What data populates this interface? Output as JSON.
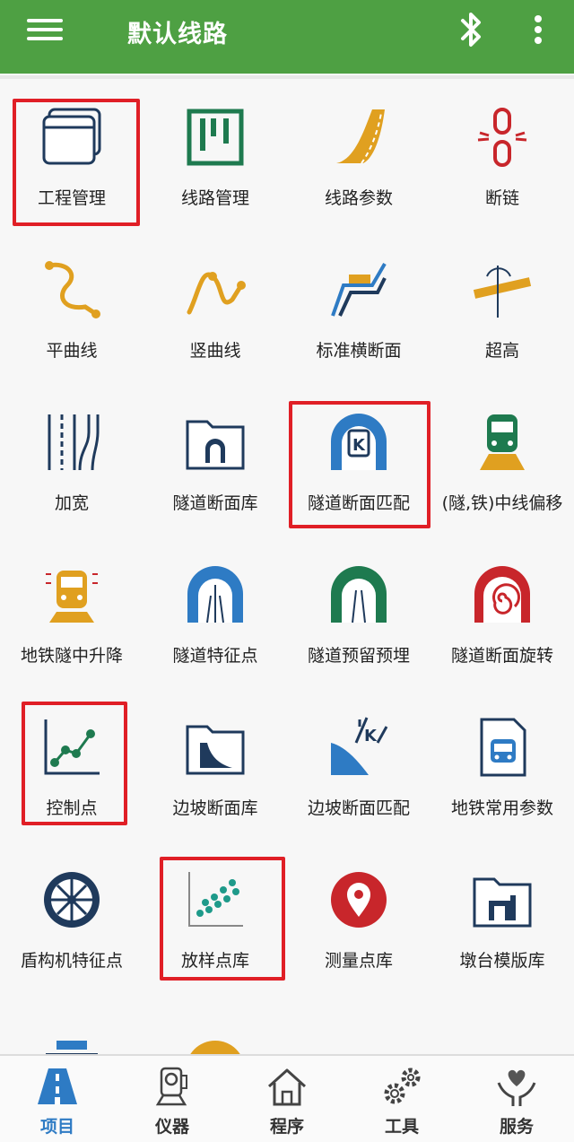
{
  "appbar": {
    "title": "默认线路",
    "menu_icon": "hamburger-icon",
    "bluetooth_icon": "bluetooth-icon",
    "more_icon": "more-vertical-icon"
  },
  "grid": {
    "items": [
      {
        "label": "工程管理",
        "icon": "project-window-icon"
      },
      {
        "label": "线路管理",
        "icon": "route-frame-icon"
      },
      {
        "label": "线路参数",
        "icon": "road-curve-icon"
      },
      {
        "label": "断链",
        "icon": "broken-chain-icon"
      },
      {
        "label": "平曲线",
        "icon": "horizontal-curve-icon"
      },
      {
        "label": "竖曲线",
        "icon": "vertical-curve-icon"
      },
      {
        "label": "标准横断面",
        "icon": "cross-section-icon"
      },
      {
        "label": "超高",
        "icon": "superelevation-icon"
      },
      {
        "label": "加宽",
        "icon": "widening-lanes-icon"
      },
      {
        "label": "隧道断面库",
        "icon": "tunnel-folder-icon"
      },
      {
        "label": "隧道断面匹配",
        "icon": "tunnel-match-icon"
      },
      {
        "label": "(隧,铁)中线偏移",
        "icon": "train-offset-icon"
      },
      {
        "label": "地铁隧中升降",
        "icon": "metro-train-icon"
      },
      {
        "label": "隧道特征点",
        "icon": "tunnel-feature-icon"
      },
      {
        "label": "隧道预留预埋",
        "icon": "tunnel-reserve-icon"
      },
      {
        "label": "隧道断面旋转",
        "icon": "tunnel-rotate-icon"
      },
      {
        "label": "控制点",
        "icon": "control-point-chart-icon"
      },
      {
        "label": "边坡断面库",
        "icon": "slope-folder-icon"
      },
      {
        "label": "边坡断面匹配",
        "icon": "slope-match-icon"
      },
      {
        "label": "地铁常用参数",
        "icon": "metro-doc-icon"
      },
      {
        "label": "盾构机特征点",
        "icon": "shield-machine-icon"
      },
      {
        "label": "放样点库",
        "icon": "stakeout-points-icon"
      },
      {
        "label": "测量点库",
        "icon": "map-pin-icon"
      },
      {
        "label": "墩台模版库",
        "icon": "pier-folder-icon"
      },
      {
        "label": "",
        "icon": "road-partial-icon"
      },
      {
        "label": "",
        "icon": "yellow-circle-icon"
      }
    ]
  },
  "tabs": [
    {
      "label": "项目",
      "icon": "road-tab-icon",
      "active": true
    },
    {
      "label": "仪器",
      "icon": "instrument-icon",
      "active": false
    },
    {
      "label": "程序",
      "icon": "house-icon",
      "active": false
    },
    {
      "label": "工具",
      "icon": "gears-icon",
      "active": false
    },
    {
      "label": "服务",
      "icon": "service-heart-icon",
      "active": false
    }
  ],
  "colors": {
    "appbar": "#4ea043",
    "highlight": "#e01f26",
    "navy": "#1f3a5c",
    "green": "#1e7a4f",
    "gold": "#e0a020",
    "blue": "#2e7bc4",
    "red": "#c8262b"
  }
}
